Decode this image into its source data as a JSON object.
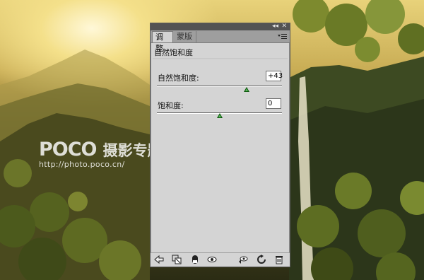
{
  "watermark": {
    "logo": "POCO",
    "title": "摄影专题",
    "url": "http://photo.poco.cn/"
  },
  "panel": {
    "tabs": [
      {
        "label": "调整",
        "active": true
      },
      {
        "label": "蒙版",
        "active": false
      }
    ],
    "heading": "自然饱和度",
    "controls": [
      {
        "label": "自然饱和度:",
        "value": "+43",
        "slider_percent": 72
      },
      {
        "label": "饱和度:",
        "value": "0",
        "slider_percent": 50
      }
    ],
    "bottom_tools": [
      "back-arrow-icon",
      "clip-layer-icon",
      "layer-mask-icon",
      "eye-icon",
      "view-previous-icon",
      "reset-icon",
      "trash-icon"
    ]
  },
  "colors": {
    "panel_bg": "#d4d4d4",
    "slider_thumb": "#0d5a0d"
  }
}
